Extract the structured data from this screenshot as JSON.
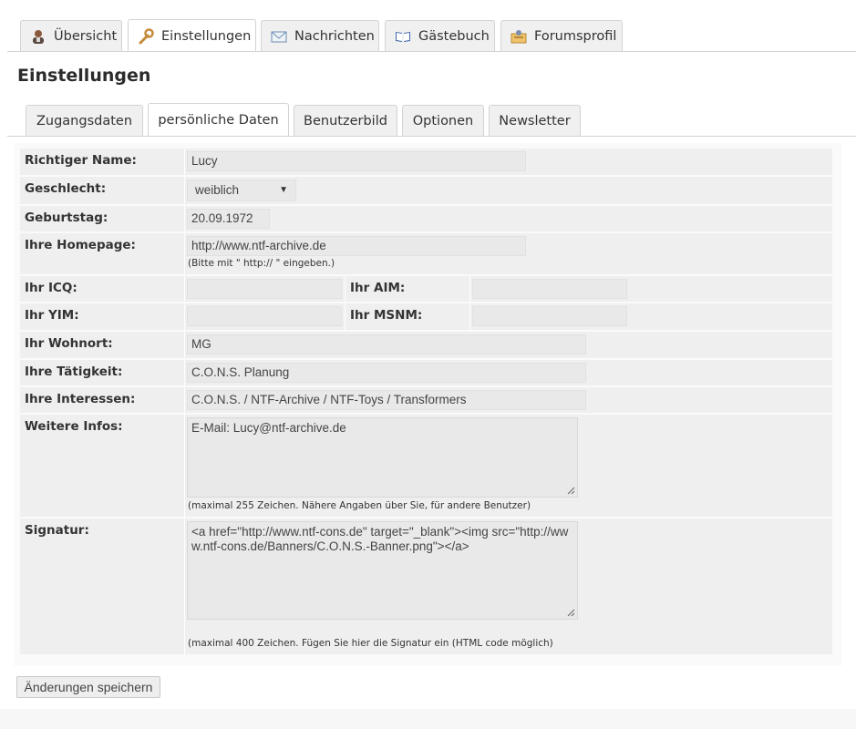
{
  "top_tabs": [
    {
      "label": "Übersicht",
      "icon": "user-icon"
    },
    {
      "label": "Einstellungen",
      "icon": "wrench-icon"
    },
    {
      "label": "Nachrichten",
      "icon": "envelope-icon"
    },
    {
      "label": "Gästebuch",
      "icon": "book-icon"
    },
    {
      "label": "Forumsprofil",
      "icon": "profile-card-icon"
    }
  ],
  "page_title": "Einstellungen",
  "sub_tabs": [
    "Zugangsdaten",
    "persönliche Daten",
    "Benutzerbild",
    "Optionen",
    "Newsletter"
  ],
  "form": {
    "real_name": {
      "label": "Richtiger Name:",
      "value": "Lucy"
    },
    "gender": {
      "label": "Geschlecht:",
      "value": "weiblich"
    },
    "birthday": {
      "label": "Geburtstag:",
      "value": "20.09.1972"
    },
    "homepage": {
      "label": "Ihre Homepage:",
      "value": "http://www.ntf-archive.de",
      "hint": "(Bitte mit \" http:// \" eingeben.)"
    },
    "icq": {
      "label": "Ihr ICQ:",
      "value": ""
    },
    "aim": {
      "label": "Ihr AIM:",
      "value": ""
    },
    "yim": {
      "label": "Ihr YIM:",
      "value": ""
    },
    "msnm": {
      "label": "Ihr MSNM:",
      "value": ""
    },
    "residence": {
      "label": "Ihr Wohnort:",
      "value": "MG"
    },
    "occupation": {
      "label": "Ihre Tätigkeit:",
      "value": "C.O.N.S. Planung"
    },
    "interests": {
      "label": "Ihre Interessen:",
      "value": "C.O.N.S. / NTF-Archive / NTF-Toys / Transformers"
    },
    "more_info": {
      "label": "Weitere Infos:",
      "value": "E-Mail: Lucy@ntf-archive.de",
      "hint": "(maximal 255 Zeichen. Nähere Angaben über Sie, für andere Benutzer)"
    },
    "signature": {
      "label": "Signatur:",
      "value": "<a href=\"http://www.ntf-cons.de\" target=\"_blank\"><img src=\"http://www.ntf-cons.de/Banners/C.O.N.S.-Banner.png\"></a>",
      "hint": "(maximal 400 Zeichen. Fügen Sie hier die Signatur ein (HTML code möglich)"
    }
  },
  "save_button": "Änderungen speichern"
}
